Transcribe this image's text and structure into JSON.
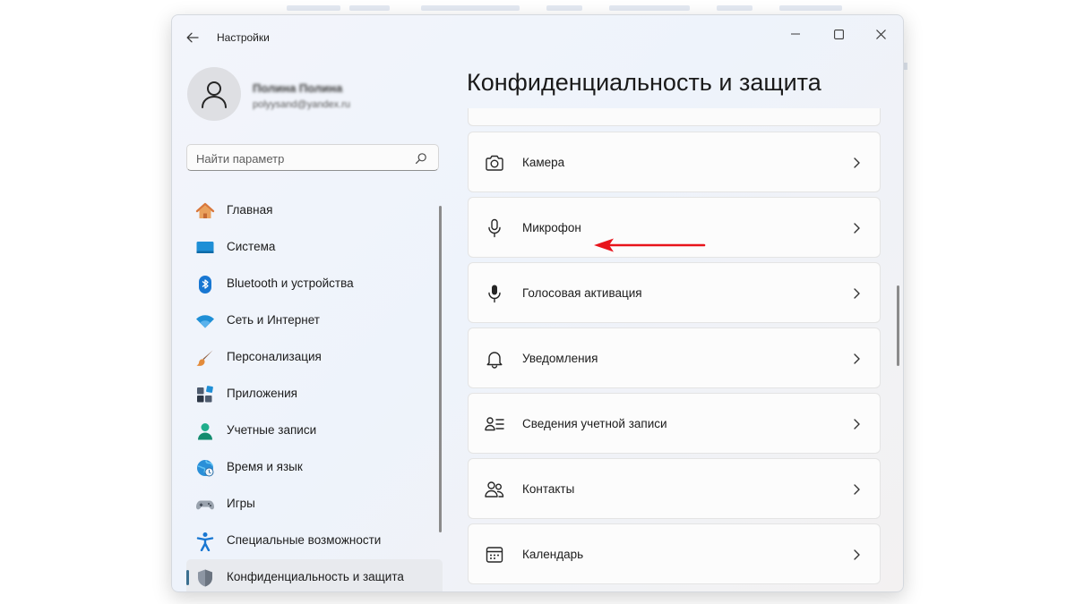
{
  "window": {
    "title": "Настройки"
  },
  "user": {
    "name": "Полина Полина",
    "email": "polyysand@yandex.ru"
  },
  "search": {
    "placeholder": "Найти параметр",
    "value": ""
  },
  "nav": {
    "items": [
      {
        "label": "Главная",
        "icon": "home-icon"
      },
      {
        "label": "Система",
        "icon": "display-icon"
      },
      {
        "label": "Bluetooth и устройства",
        "icon": "bluetooth-icon"
      },
      {
        "label": "Сеть и Интернет",
        "icon": "wifi-icon"
      },
      {
        "label": "Персонализация",
        "icon": "brush-icon"
      },
      {
        "label": "Приложения",
        "icon": "apps-icon"
      },
      {
        "label": "Учетные записи",
        "icon": "person-icon"
      },
      {
        "label": "Время и язык",
        "icon": "globe-clock-icon"
      },
      {
        "label": "Игры",
        "icon": "gamepad-icon"
      },
      {
        "label": "Специальные возможности",
        "icon": "accessibility-icon"
      },
      {
        "label": "Конфиденциальность и защита",
        "icon": "shield-icon",
        "active": true
      }
    ]
  },
  "page": {
    "title": "Конфиденциальность и защита"
  },
  "permissions": [
    {
      "label": "Камера",
      "icon": "camera-icon"
    },
    {
      "label": "Микрофон",
      "icon": "microphone-icon"
    },
    {
      "label": "Голосовая активация",
      "icon": "voice-activation-icon"
    },
    {
      "label": "Уведомления",
      "icon": "bell-icon"
    },
    {
      "label": "Сведения учетной записи",
      "icon": "account-info-icon"
    },
    {
      "label": "Контакты",
      "icon": "contacts-icon"
    },
    {
      "label": "Календарь",
      "icon": "calendar-icon"
    }
  ],
  "annotation": {
    "target": "Микрофон",
    "color": "#e8141b"
  },
  "colors": {
    "accent": "#3a6f8f",
    "window_bg": "#f0f4fa",
    "card_bg": "#fcfcfc"
  }
}
